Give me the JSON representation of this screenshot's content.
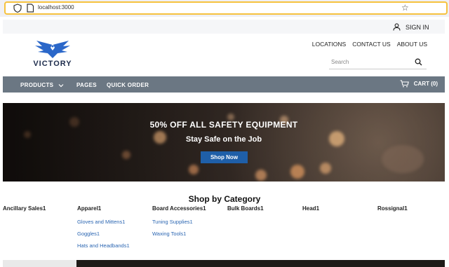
{
  "browser": {
    "url": "localhost:3000"
  },
  "header": {
    "sign_in": "SIGN IN",
    "brand": "VICTORY",
    "links": [
      "LOCATIONS",
      "CONTACT US",
      "ABOUT US"
    ],
    "search_placeholder": "Search"
  },
  "nav": {
    "products": "PRODUCTS",
    "pages": "PAGES",
    "quick_order": "QUICK ORDER",
    "cart": "CART (0)"
  },
  "hero": {
    "title": "50% OFF ALL SAFETY EQUIPMENT",
    "subtitle": "Stay Safe on the Job",
    "button": "Shop Now"
  },
  "categories": {
    "title": "Shop by Category",
    "columns": [
      {
        "name": "Ancillary Sales1",
        "subs": []
      },
      {
        "name": "Apparel1",
        "subs": [
          "Gloves and Mittens1",
          "Goggles1",
          "Hats and Headbands1"
        ]
      },
      {
        "name": "Board Accessories1",
        "subs": [
          "Tuning Supplies1",
          "Waxing Tools1"
        ]
      },
      {
        "name": "Bulk Boards1",
        "subs": []
      },
      {
        "name": "Head1",
        "subs": []
      },
      {
        "name": "Rossignal1",
        "subs": []
      }
    ]
  },
  "colors": {
    "nav_bg": "#6b7783",
    "button": "#1f5fa8",
    "link": "#2b66b2",
    "url_focus": "#f6c23e"
  }
}
